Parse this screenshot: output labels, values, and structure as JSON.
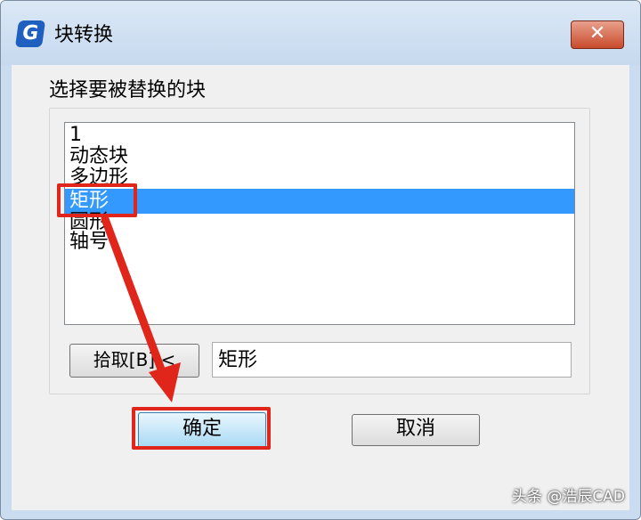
{
  "window": {
    "title": "块转换",
    "icon_letter": "G",
    "close_symbol": "✕"
  },
  "dialog": {
    "prompt_label": "选择要被替换的块",
    "list_items": [
      "1",
      "动态块",
      "多边形",
      "矩形",
      "圆形",
      "轴号"
    ],
    "selected_item": "矩形",
    "pick_button_label": "拾取[B] <",
    "name_field_value": "矩形",
    "ok_label": "确定",
    "cancel_label": "取消"
  },
  "watermark": "头条 @浩辰CAD",
  "colors": {
    "selection": "#3399ff",
    "annotation_red": "#e0251b"
  }
}
